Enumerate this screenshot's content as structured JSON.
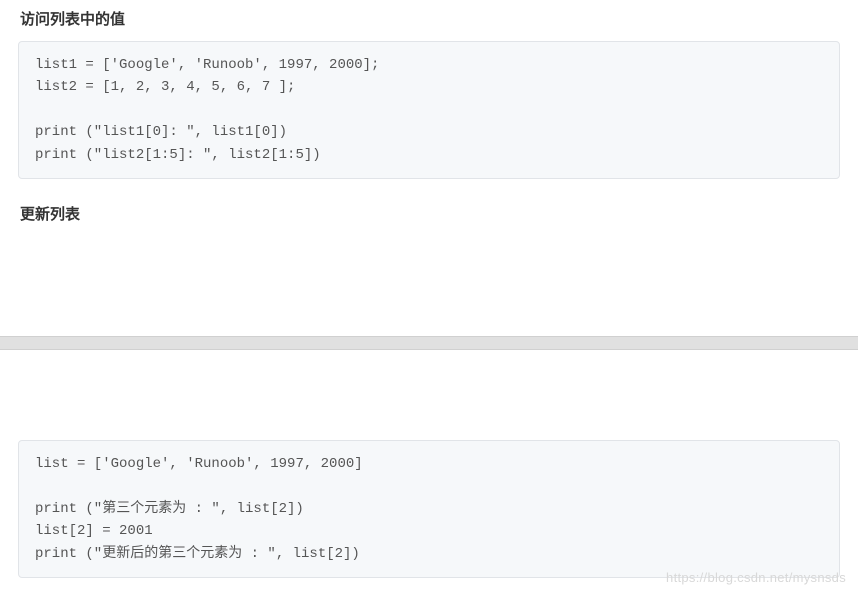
{
  "sections": {
    "access": {
      "heading": "访问列表中的值",
      "code": "list1 = ['Google', 'Runoob', 1997, 2000];\nlist2 = [1, 2, 3, 4, 5, 6, 7 ];\n \nprint (\"list1[0]: \", list1[0])\nprint (\"list2[1:5]: \", list2[1:5])"
    },
    "update": {
      "heading": "更新列表",
      "code": "list = ['Google', 'Runoob', 1997, 2000]\n \nprint (\"第三个元素为 : \", list[2])\nlist[2] = 2001\nprint (\"更新后的第三个元素为 : \", list[2])"
    }
  },
  "watermark": "https://blog.csdn.net/mysnsds"
}
